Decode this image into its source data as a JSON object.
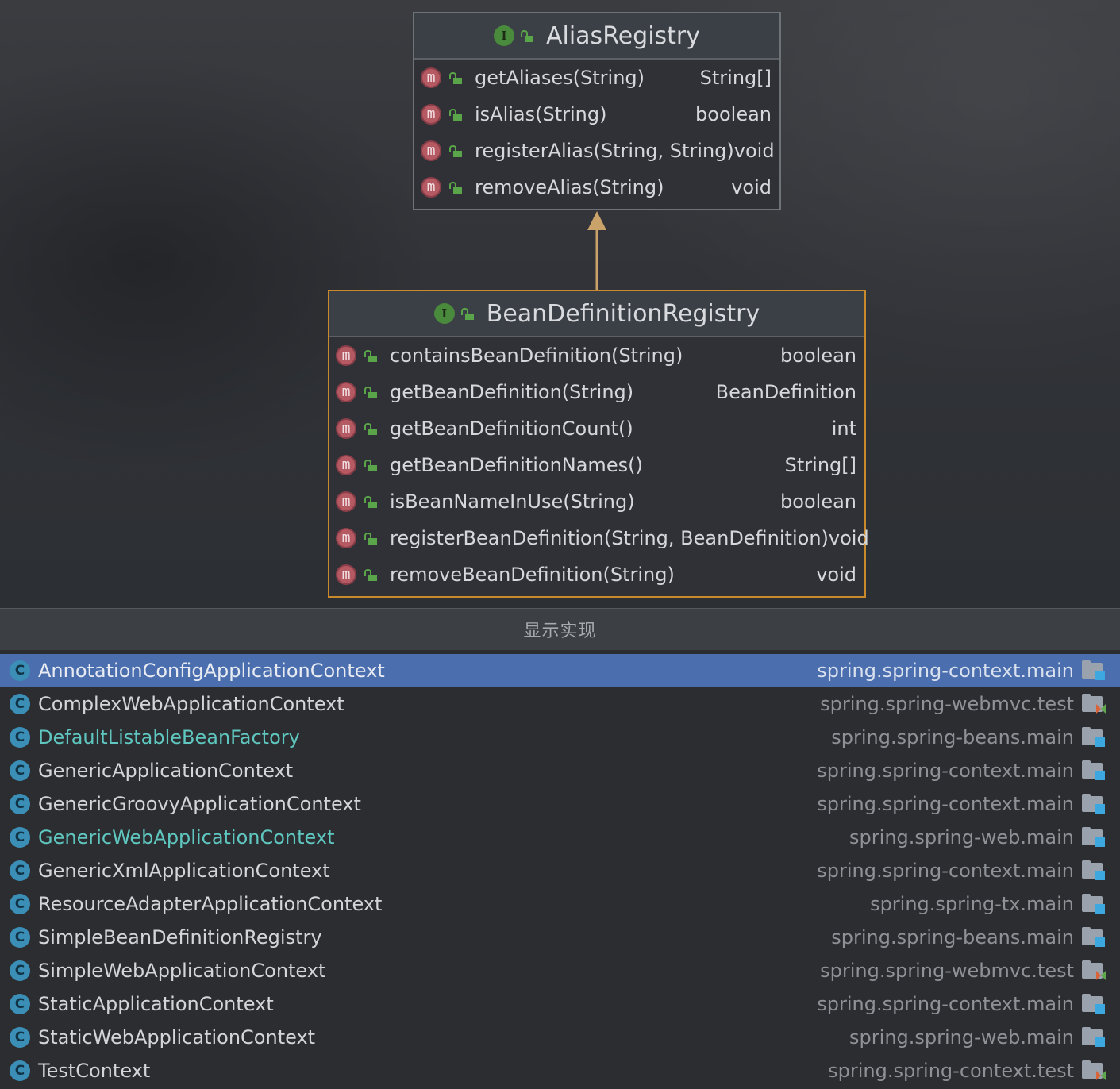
{
  "diagram": {
    "parent": {
      "name": "AliasRegistry",
      "kind_badge": "I",
      "methods": [
        {
          "name": "getAliases(String)",
          "returns": "String[]"
        },
        {
          "name": "isAlias(String)",
          "returns": "boolean"
        },
        {
          "name": "registerAlias(String, String)",
          "returns": "void"
        },
        {
          "name": "removeAlias(String)",
          "returns": "void"
        }
      ]
    },
    "child": {
      "name": "BeanDefinitionRegistry",
      "kind_badge": "I",
      "methods": [
        {
          "name": "containsBeanDefinition(String)",
          "returns": "boolean"
        },
        {
          "name": "getBeanDefinition(String)",
          "returns": "BeanDefinition"
        },
        {
          "name": "getBeanDefinitionCount()",
          "returns": "int"
        },
        {
          "name": "getBeanDefinitionNames()",
          "returns": "String[]"
        },
        {
          "name": "isBeanNameInUse(String)",
          "returns": "boolean"
        },
        {
          "name": "registerBeanDefinition(String, BeanDefinition)",
          "returns": "void"
        },
        {
          "name": "removeBeanDefinition(String)",
          "returns": "void"
        }
      ]
    },
    "method_badge": "m",
    "colors": {
      "child_border": "#c98a2c",
      "arrow": "#c9a36a"
    }
  },
  "implementations": {
    "title": "显示实现",
    "class_badge": "C",
    "items": [
      {
        "name": "AnnotationConfigApplicationContext",
        "module": "spring.spring-context.main",
        "selected": true,
        "teal": false,
        "test": false
      },
      {
        "name": "ComplexWebApplicationContext",
        "module": "spring.spring-webmvc.test",
        "selected": false,
        "teal": false,
        "test": true
      },
      {
        "name": "DefaultListableBeanFactory",
        "module": "spring.spring-beans.main",
        "selected": false,
        "teal": true,
        "test": false
      },
      {
        "name": "GenericApplicationContext",
        "module": "spring.spring-context.main",
        "selected": false,
        "teal": false,
        "test": false
      },
      {
        "name": "GenericGroovyApplicationContext",
        "module": "spring.spring-context.main",
        "selected": false,
        "teal": false,
        "test": false
      },
      {
        "name": "GenericWebApplicationContext",
        "module": "spring.spring-web.main",
        "selected": false,
        "teal": true,
        "test": false
      },
      {
        "name": "GenericXmlApplicationContext",
        "module": "spring.spring-context.main",
        "selected": false,
        "teal": false,
        "test": false
      },
      {
        "name": "ResourceAdapterApplicationContext",
        "module": "spring.spring-tx.main",
        "selected": false,
        "teal": false,
        "test": false
      },
      {
        "name": "SimpleBeanDefinitionRegistry",
        "module": "spring.spring-beans.main",
        "selected": false,
        "teal": false,
        "test": false
      },
      {
        "name": "SimpleWebApplicationContext",
        "module": "spring.spring-webmvc.test",
        "selected": false,
        "teal": false,
        "test": true
      },
      {
        "name": "StaticApplicationContext",
        "module": "spring.spring-context.main",
        "selected": false,
        "teal": false,
        "test": false
      },
      {
        "name": "StaticWebApplicationContext",
        "module": "spring.spring-web.main",
        "selected": false,
        "teal": false,
        "test": false
      },
      {
        "name": "TestContext",
        "module": "spring.spring-context.test",
        "selected": false,
        "teal": false,
        "test": true
      }
    ]
  }
}
